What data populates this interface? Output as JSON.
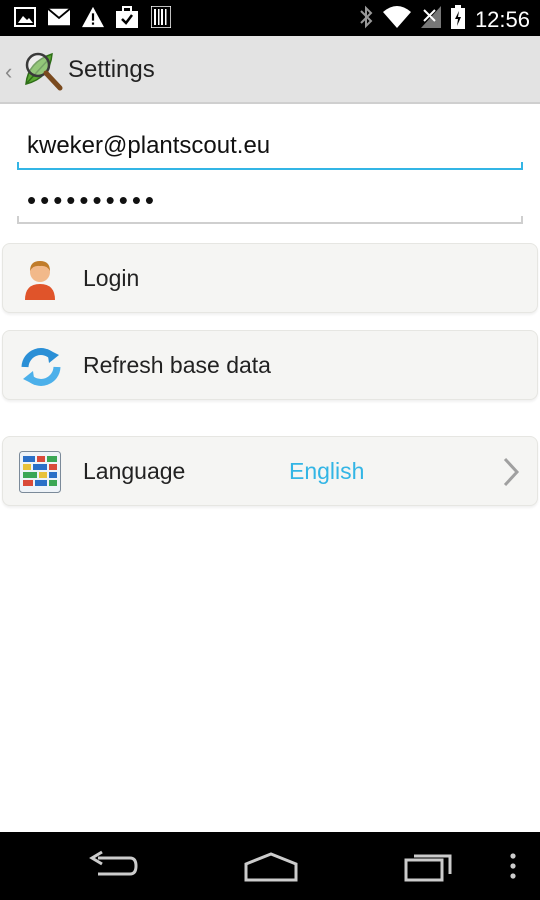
{
  "status_bar": {
    "time": "12:56",
    "icons": [
      "image-icon",
      "email-icon",
      "warning-icon",
      "briefcase-icon",
      "barcode-icon",
      "bluetooth-icon",
      "wifi-icon",
      "signal-icon",
      "battery-icon"
    ]
  },
  "action_bar": {
    "title": "Settings",
    "app_icon": "plantscout-leaf-magnifier-icon"
  },
  "form": {
    "email_value": "kweker@plantscout.eu",
    "password_value": "••••••••••"
  },
  "items": {
    "login": {
      "label": "Login",
      "icon": "user-icon"
    },
    "refresh": {
      "label": "Refresh base data",
      "icon": "refresh-icon"
    },
    "language": {
      "label": "Language",
      "value": "English",
      "icon": "language-grid-icon"
    }
  },
  "colors": {
    "accent": "#33b5e5",
    "status_bar": "#000000",
    "action_bar": "#e3e3e3",
    "card_bg": "#f5f5f3"
  },
  "nav_bar": {
    "buttons": [
      "back-icon",
      "home-icon",
      "recent-apps-icon",
      "overflow-menu-icon"
    ]
  }
}
